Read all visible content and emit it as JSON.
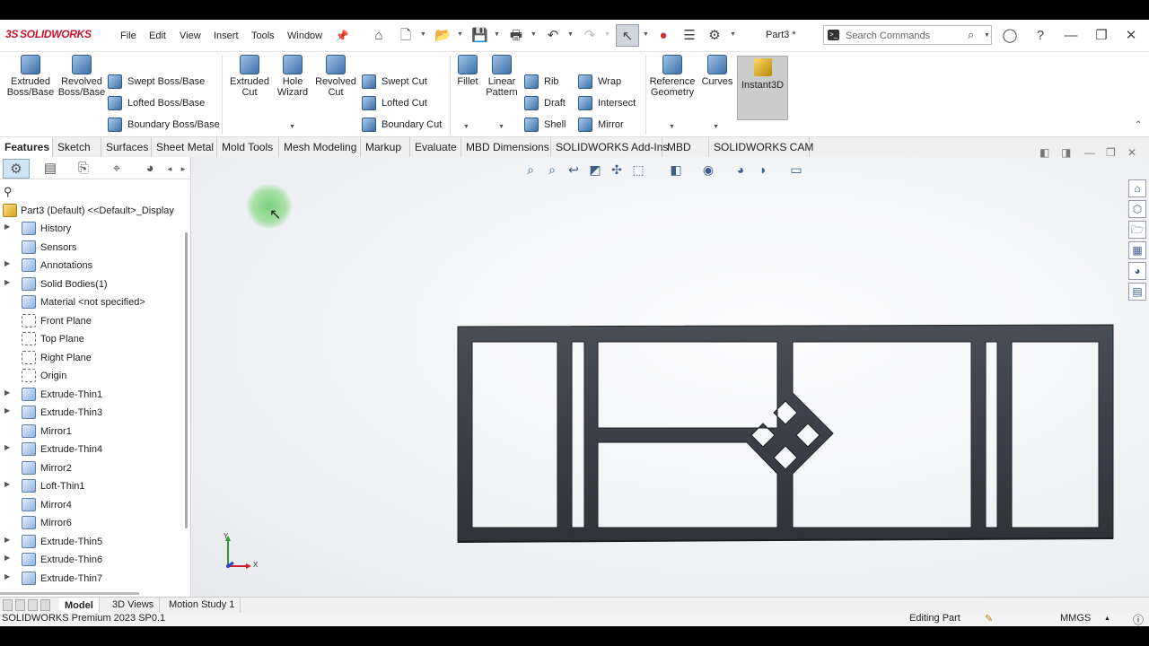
{
  "app": {
    "brand": "SOLIDWORKS",
    "document_title": "Part3 *"
  },
  "menus": [
    "File",
    "Edit",
    "View",
    "Insert",
    "Tools",
    "Window"
  ],
  "search": {
    "placeholder": "Search Commands"
  },
  "ribbon": {
    "extruded_boss": "Extruded Boss/Base",
    "revolved_boss": "Revolved Boss/Base",
    "swept_boss": "Swept Boss/Base",
    "lofted_boss": "Lofted Boss/Base",
    "boundary_boss": "Boundary Boss/Base",
    "extruded_cut": "Extruded Cut",
    "hole_wizard": "Hole Wizard",
    "revolved_cut": "Revolved Cut",
    "swept_cut": "Swept Cut",
    "lofted_cut": "Lofted Cut",
    "boundary_cut": "Boundary Cut",
    "fillet": "Fillet",
    "linear_pattern": "Linear Pattern",
    "rib": "Rib",
    "draft": "Draft",
    "shell": "Shell",
    "wrap": "Wrap",
    "intersect": "Intersect",
    "mirror": "Mirror",
    "reference_geometry": "Reference Geometry",
    "curves": "Curves",
    "instant3d": "Instant3D"
  },
  "command_tabs": [
    "Features",
    "Sketch",
    "Surfaces",
    "Sheet Metal",
    "Mold Tools",
    "Mesh Modeling",
    "Markup",
    "Evaluate",
    "MBD Dimensions",
    "SOLIDWORKS Add-Ins",
    "MBD",
    "SOLIDWORKS CAM"
  ],
  "tree": {
    "root": "Part3 (Default) <<Default>_Display",
    "items": [
      "History",
      "Sensors",
      "Annotations",
      "Solid Bodies(1)",
      "Material <not specified>",
      "Front Plane",
      "Top Plane",
      "Right Plane",
      "Origin",
      "Extrude-Thin1",
      "Extrude-Thin3",
      "Mirror1",
      "Extrude-Thin4",
      "Mirror2",
      "Loft-Thin1",
      "Mirror4",
      "Mirror6",
      "Extrude-Thin5",
      "Extrude-Thin6",
      "Extrude-Thin7"
    ]
  },
  "triad": {
    "y": "Y",
    "x": "X"
  },
  "bottom_tabs": [
    "Model",
    "3D Views",
    "Motion Study 1"
  ],
  "status": {
    "version": "SOLIDWORKS Premium 2023 SP0.1",
    "mode": "Editing Part",
    "units": "MMGS"
  },
  "colors": {
    "brand": "#c8102e",
    "model": "#3f4247",
    "ribbon_bg": "#ffffff"
  }
}
